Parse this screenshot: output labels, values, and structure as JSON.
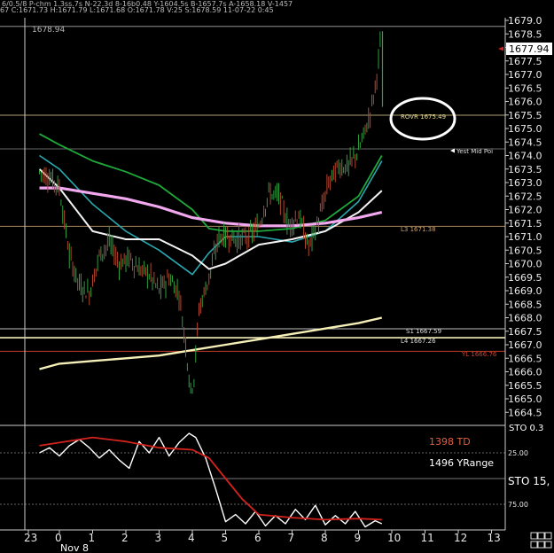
{
  "header": {
    "ohlc_text": "6/0.5/8 P-chm 1.3ss.7s N-22.3d 8-16b0.48 Y-1604.5s B-1657.7s A-1658.18 V-1457",
    "bar_text": "67 C:1671.73 H:1671.79 L:1671.68 O:1671.78 V:25 S:1678.59 11-07-22 0:45"
  },
  "colors": {
    "background": "#000000",
    "up_bar": "#2e9e3e",
    "down_bar": "#b2452f",
    "ma_green": "#1ea83a",
    "ma_teal": "#2aa8b0",
    "ma_white": "#f4f4f4",
    "ma_magenta": "#f2a8ee",
    "ma_yellow": "#f5f0b8",
    "level_line": "#a88660",
    "yl_line": "#c43c2a",
    "sto_white": "#ffffff",
    "sto_red": "#d4231c"
  },
  "chart_data": [
    {
      "type": "candlestick",
      "title": "",
      "ylim": [
        1664.4,
        1679.1
      ],
      "xlim": [
        -0.6,
        13.5
      ],
      "y_ticks": [
        "1679.0",
        "1678.5",
        "1678.0",
        "1677.5",
        "1677.0",
        "1676.5",
        "1676.0",
        "1675.5",
        "1675.0",
        "1674.5",
        "1674.0",
        "1673.5",
        "1673.0",
        "1672.5",
        "1672.0",
        "1671.5",
        "1671.0",
        "1670.5",
        "1670.0",
        "1669.5",
        "1669.0",
        "1668.5",
        "1668.0",
        "1667.5",
        "1667.0",
        "1666.5",
        "1666.0",
        "1665.5",
        "1665.0",
        "1664.5"
      ],
      "y_tick_values": [
        1679.0,
        1678.5,
        1678.0,
        1677.5,
        1677.0,
        1676.5,
        1676.0,
        1675.5,
        1675.0,
        1674.5,
        1674.0,
        1673.5,
        1673.0,
        1672.5,
        1672.0,
        1671.5,
        1671.0,
        1670.5,
        1670.0,
        1669.5,
        1669.0,
        1668.5,
        1668.0,
        1667.5,
        1667.0,
        1666.5,
        1666.0,
        1665.5,
        1665.0,
        1664.5
      ],
      "last_price": "1677.94",
      "last_price_value": 1677.94,
      "top_label": "1678.94",
      "top_label_value": 1678.94,
      "levels": [
        {
          "label": "ROVR 1675.49",
          "value": 1675.49
        },
        {
          "label": "Yest Mid Poi",
          "value": 1674.8
        },
        {
          "label": "L3 1671.38",
          "value": 1671.38
        },
        {
          "label": "S1 1667.59",
          "value": 1667.59
        },
        {
          "label": "L4 1667.26",
          "value": 1667.26
        },
        {
          "label": "YL 1666.76",
          "value": 1666.76
        }
      ],
      "series": [
        {
          "name": "",
          "kind": "price",
          "x": [
            -0.6,
            -0.3,
            0,
            0.3,
            0.6,
            0.9,
            1.2,
            1.5,
            1.8,
            2.1,
            2.4,
            2.7,
            3.0,
            3.3,
            3.6,
            3.8,
            3.95,
            4.05,
            4.2,
            4.5,
            4.8,
            5.1,
            5.4,
            5.7,
            6.0,
            6.3,
            6.6,
            6.9,
            7.2,
            7.5,
            7.8,
            8.1,
            8.4,
            8.7,
            9.0,
            9.3,
            9.5,
            9.7
          ],
          "y": [
            1673.4,
            1673.2,
            1672.8,
            1670.3,
            1669.2,
            1668.9,
            1670.3,
            1670.8,
            1670.0,
            1670.2,
            1669.8,
            1669.6,
            1669.0,
            1669.5,
            1668.9,
            1667.0,
            1665.3,
            1665.8,
            1668.3,
            1669.5,
            1671.0,
            1671.0,
            1670.9,
            1671.0,
            1671.4,
            1672.6,
            1672.5,
            1671.4,
            1671.8,
            1670.6,
            1671.6,
            1673.0,
            1673.6,
            1673.6,
            1674.2,
            1675.3,
            1676.5,
            1678.6
          ]
        },
        {
          "name": "",
          "kind": "ma_green",
          "x": [
            -0.6,
            0,
            1,
            2,
            3,
            4,
            4.5,
            5,
            6,
            7,
            8,
            9,
            9.7
          ],
          "y": [
            1674.8,
            1674.4,
            1673.8,
            1673.4,
            1672.9,
            1672.0,
            1671.3,
            1671.2,
            1671.2,
            1671.3,
            1671.6,
            1672.5,
            1674.0
          ]
        },
        {
          "name": "",
          "kind": "ma_teal",
          "x": [
            -0.6,
            0,
            1,
            2,
            3,
            4,
            4.5,
            5,
            6,
            7,
            8,
            9,
            9.7
          ],
          "y": [
            1674.0,
            1673.5,
            1672.2,
            1671.2,
            1670.5,
            1669.6,
            1670.4,
            1671.0,
            1671.0,
            1670.8,
            1671.2,
            1672.3,
            1673.8
          ]
        },
        {
          "name": "",
          "kind": "ma_white",
          "x": [
            -0.6,
            0,
            1,
            2,
            3,
            4,
            4.5,
            5,
            6,
            7,
            8,
            9,
            9.7
          ],
          "y": [
            1673.5,
            1672.8,
            1671.2,
            1670.9,
            1670.9,
            1670.3,
            1669.8,
            1670.0,
            1670.7,
            1670.9,
            1671.2,
            1671.9,
            1672.7
          ]
        },
        {
          "name": "",
          "kind": "ma_magenta",
          "x": [
            -0.6,
            0,
            1,
            2,
            3,
            4,
            5,
            6,
            7,
            8,
            9,
            9.7
          ],
          "y": [
            1672.8,
            1672.8,
            1672.6,
            1672.4,
            1672.1,
            1671.7,
            1671.5,
            1671.4,
            1671.4,
            1671.5,
            1671.7,
            1671.9
          ]
        },
        {
          "name": "",
          "kind": "ma_yellow",
          "x": [
            -0.6,
            0,
            1,
            2,
            3,
            4,
            5,
            6,
            7,
            8,
            9,
            9.7
          ],
          "y": [
            1666.1,
            1666.3,
            1666.4,
            1666.5,
            1666.6,
            1666.8,
            1667.0,
            1667.2,
            1667.4,
            1667.6,
            1667.8,
            1668.0
          ]
        }
      ]
    },
    {
      "type": "line",
      "title": "",
      "ylim": [
        0,
        100
      ],
      "y_ticks": [
        "25.00",
        "75.00"
      ],
      "y_tick_values": [
        75,
        25
      ],
      "x_ticks": [
        "23",
        "0",
        "1",
        "2",
        "3",
        "4",
        "5",
        "6",
        "7",
        "8",
        "9",
        "10",
        "11",
        "12",
        "13"
      ],
      "x_tick_values": [
        -1,
        0,
        1,
        2,
        3,
        4,
        5,
        6,
        7,
        8,
        9,
        10,
        11,
        12,
        13
      ],
      "date_label": "Nov 8",
      "labels": [
        "1398 TD",
        "1496 YRange",
        "STO 15,"
      ],
      "top_clip_label": "STO 0.3",
      "series": [
        {
          "name": "",
          "kind": "sto_white",
          "x": [
            -0.6,
            -0.3,
            0,
            0.3,
            0.6,
            0.9,
            1.2,
            1.5,
            1.8,
            2.1,
            2.4,
            2.7,
            3.0,
            3.3,
            3.6,
            3.9,
            4.1,
            4.4,
            4.7,
            5.0,
            5.3,
            5.6,
            5.9,
            6.2,
            6.5,
            6.8,
            7.1,
            7.4,
            7.7,
            8.0,
            8.3,
            8.6,
            8.9,
            9.2,
            9.5,
            9.7
          ],
          "y": [
            75,
            80,
            72,
            82,
            88,
            80,
            70,
            78,
            68,
            60,
            86,
            75,
            90,
            72,
            85,
            94,
            90,
            70,
            40,
            8,
            15,
            6,
            18,
            4,
            14,
            6,
            20,
            10,
            24,
            5,
            14,
            6,
            18,
            3,
            9,
            6
          ]
        },
        {
          "name": "",
          "kind": "sto_red",
          "x": [
            -0.6,
            0,
            1,
            2,
            3,
            4,
            4.5,
            5,
            5.5,
            6,
            7,
            8,
            9,
            9.7
          ],
          "y": [
            82,
            85,
            90,
            86,
            80,
            78,
            70,
            50,
            30,
            15,
            12,
            10,
            11,
            10
          ]
        }
      ]
    }
  ]
}
